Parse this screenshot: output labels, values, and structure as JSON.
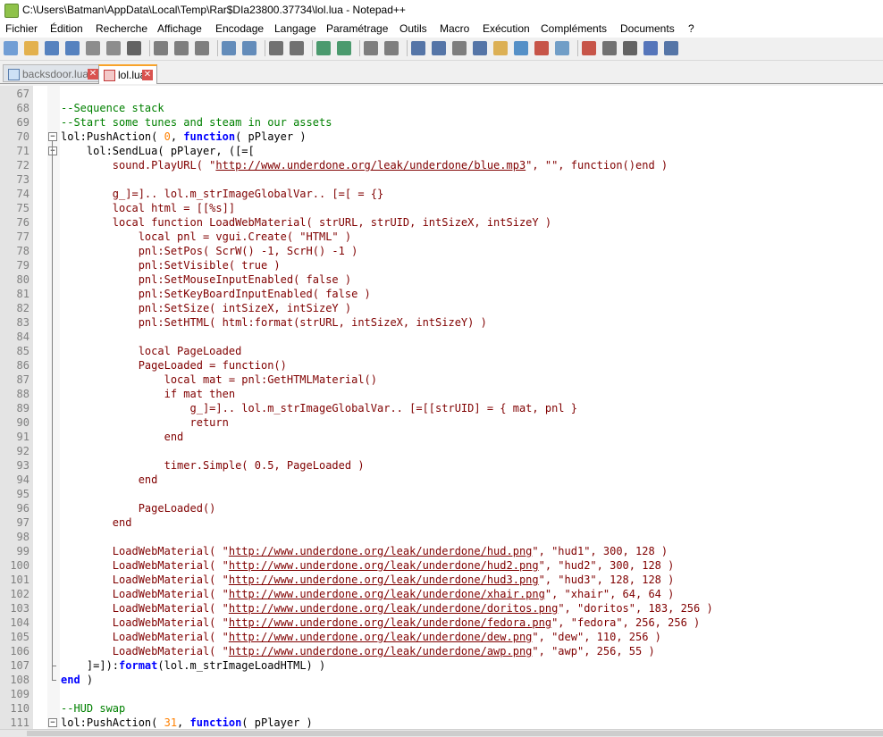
{
  "window": {
    "title": "C:\\Users\\Batman\\AppData\\Local\\Temp\\Rar$DIa23800.37734\\lol.lua - Notepad++"
  },
  "menu": [
    "Fichier",
    "Édition",
    "Recherche",
    "Affichage",
    "Encodage",
    "Langage",
    "Paramétrage",
    "Outils",
    "Macro",
    "Exécution",
    "Compléments",
    "Documents",
    "?"
  ],
  "tabs": [
    {
      "label": "backsdoor.lua",
      "close": "✕"
    },
    {
      "label": "lol.lua",
      "close": "✕"
    }
  ],
  "colors": {
    "comment": "#008000",
    "keyword": "#0000ff",
    "string": "#800000",
    "number": "#ff8000",
    "tab_accent": "#f8a32a"
  },
  "toolbar_icons": [
    "new-file-icon",
    "open-file-icon",
    "save-icon",
    "save-all-icon",
    "close-icon",
    "close-all-icon",
    "print-icon",
    "cut-icon",
    "copy-icon",
    "paste-icon",
    "undo-icon",
    "redo-icon",
    "find-icon",
    "replace-icon",
    "zoom-in-icon",
    "zoom-out-icon",
    "sync-vertical-icon",
    "sync-horizontal-icon",
    "word-wrap-icon",
    "show-all-chars-icon",
    "indent-guide-icon",
    "function-list-icon",
    "folder-workspace-icon",
    "doc-map-icon",
    "user-lang-icon",
    "monitor-icon",
    "record-macro-icon",
    "stop-macro-icon",
    "play-macro-icon",
    "run-macro-multiple-icon",
    "save-macro-icon"
  ],
  "code": [
    {
      "n": "67",
      "t": []
    },
    {
      "n": "68",
      "t": [
        {
          "c": "cm",
          "s": "--Sequence stack"
        }
      ]
    },
    {
      "n": "69",
      "t": [
        {
          "c": "cm",
          "s": "--Start some tunes and steam in our assets"
        }
      ]
    },
    {
      "n": "70",
      "t": [
        {
          "c": "",
          "s": "lol:PushAction( "
        },
        {
          "c": "num",
          "s": "0"
        },
        {
          "c": "",
          "s": ", "
        },
        {
          "c": "kw",
          "s": "function"
        },
        {
          "c": "",
          "s": "( pPlayer )"
        }
      ]
    },
    {
      "n": "71",
      "t": [
        {
          "c": "",
          "s": "    lol:SendLua( pPlayer, ([=["
        }
      ]
    },
    {
      "n": "72",
      "t": [
        {
          "c": "st",
          "s": "        sound.PlayURL( \""
        },
        {
          "c": "st ul",
          "s": "http://www.underdone.org/leak/underdone/blue.mp3"
        },
        {
          "c": "st",
          "s": "\", \"\", function()end )"
        }
      ]
    },
    {
      "n": "73",
      "t": []
    },
    {
      "n": "74",
      "t": [
        {
          "c": "st",
          "s": "        g_]=].. lol.m_strImageGlobalVar.. [=[ = {}"
        }
      ]
    },
    {
      "n": "75",
      "t": [
        {
          "c": "st",
          "s": "        local html = [[%s]]"
        }
      ]
    },
    {
      "n": "76",
      "t": [
        {
          "c": "st",
          "s": "        local function LoadWebMaterial( strURL, strUID, intSizeX, intSizeY )"
        }
      ]
    },
    {
      "n": "77",
      "t": [
        {
          "c": "st",
          "s": "            local pnl = vgui.Create( \"HTML\" )"
        }
      ]
    },
    {
      "n": "78",
      "t": [
        {
          "c": "st",
          "s": "            pnl:SetPos( ScrW() -1, ScrH() -1 )"
        }
      ]
    },
    {
      "n": "79",
      "t": [
        {
          "c": "st",
          "s": "            pnl:SetVisible( true )"
        }
      ]
    },
    {
      "n": "80",
      "t": [
        {
          "c": "st",
          "s": "            pnl:SetMouseInputEnabled( false )"
        }
      ]
    },
    {
      "n": "81",
      "t": [
        {
          "c": "st",
          "s": "            pnl:SetKeyBoardInputEnabled( false )"
        }
      ]
    },
    {
      "n": "82",
      "t": [
        {
          "c": "st",
          "s": "            pnl:SetSize( intSizeX, intSizeY )"
        }
      ]
    },
    {
      "n": "83",
      "t": [
        {
          "c": "st",
          "s": "            pnl:SetHTML( html:format(strURL, intSizeX, intSizeY) )"
        }
      ]
    },
    {
      "n": "84",
      "t": []
    },
    {
      "n": "85",
      "t": [
        {
          "c": "st",
          "s": "            local PageLoaded"
        }
      ]
    },
    {
      "n": "86",
      "t": [
        {
          "c": "st",
          "s": "            PageLoaded = function()"
        }
      ]
    },
    {
      "n": "87",
      "t": [
        {
          "c": "st",
          "s": "                local mat = pnl:GetHTMLMaterial()"
        }
      ]
    },
    {
      "n": "88",
      "t": [
        {
          "c": "st",
          "s": "                if mat then"
        }
      ]
    },
    {
      "n": "89",
      "t": [
        {
          "c": "st",
          "s": "                    g_]=].. lol.m_strImageGlobalVar.. [=[[strUID] = { mat, pnl }"
        }
      ]
    },
    {
      "n": "90",
      "t": [
        {
          "c": "st",
          "s": "                    return"
        }
      ]
    },
    {
      "n": "91",
      "t": [
        {
          "c": "st",
          "s": "                end"
        }
      ]
    },
    {
      "n": "92",
      "t": []
    },
    {
      "n": "93",
      "t": [
        {
          "c": "st",
          "s": "                timer.Simple( 0.5, PageLoaded )"
        }
      ]
    },
    {
      "n": "94",
      "t": [
        {
          "c": "st",
          "s": "            end"
        }
      ]
    },
    {
      "n": "95",
      "t": []
    },
    {
      "n": "96",
      "t": [
        {
          "c": "st",
          "s": "            PageLoaded()"
        }
      ]
    },
    {
      "n": "97",
      "t": [
        {
          "c": "st",
          "s": "        end"
        }
      ]
    },
    {
      "n": "98",
      "t": []
    },
    {
      "n": "99",
      "t": [
        {
          "c": "st",
          "s": "        LoadWebMaterial( \""
        },
        {
          "c": "st ul",
          "s": "http://www.underdone.org/leak/underdone/hud.png"
        },
        {
          "c": "st",
          "s": "\", \"hud1\", 300, 128 )"
        }
      ]
    },
    {
      "n": "100",
      "t": [
        {
          "c": "st",
          "s": "        LoadWebMaterial( \""
        },
        {
          "c": "st ul",
          "s": "http://www.underdone.org/leak/underdone/hud2.png"
        },
        {
          "c": "st",
          "s": "\", \"hud2\", 300, 128 )"
        }
      ]
    },
    {
      "n": "101",
      "t": [
        {
          "c": "st",
          "s": "        LoadWebMaterial( \""
        },
        {
          "c": "st ul",
          "s": "http://www.underdone.org/leak/underdone/hud3.png"
        },
        {
          "c": "st",
          "s": "\", \"hud3\", 128, 128 )"
        }
      ]
    },
    {
      "n": "102",
      "t": [
        {
          "c": "st",
          "s": "        LoadWebMaterial( \""
        },
        {
          "c": "st ul",
          "s": "http://www.underdone.org/leak/underdone/xhair.png"
        },
        {
          "c": "st",
          "s": "\", \"xhair\", 64, 64 )"
        }
      ]
    },
    {
      "n": "103",
      "t": [
        {
          "c": "st",
          "s": "        LoadWebMaterial( \""
        },
        {
          "c": "st ul",
          "s": "http://www.underdone.org/leak/underdone/doritos.png"
        },
        {
          "c": "st",
          "s": "\", \"doritos\", 183, 256 )"
        }
      ]
    },
    {
      "n": "104",
      "t": [
        {
          "c": "st",
          "s": "        LoadWebMaterial( \""
        },
        {
          "c": "st ul",
          "s": "http://www.underdone.org/leak/underdone/fedora.png"
        },
        {
          "c": "st",
          "s": "\", \"fedora\", 256, 256 )"
        }
      ]
    },
    {
      "n": "105",
      "t": [
        {
          "c": "st",
          "s": "        LoadWebMaterial( \""
        },
        {
          "c": "st ul",
          "s": "http://www.underdone.org/leak/underdone/dew.png"
        },
        {
          "c": "st",
          "s": "\", \"dew\", 110, 256 )"
        }
      ]
    },
    {
      "n": "106",
      "t": [
        {
          "c": "st",
          "s": "        LoadWebMaterial( \""
        },
        {
          "c": "st ul",
          "s": "http://www.underdone.org/leak/underdone/awp.png"
        },
        {
          "c": "st",
          "s": "\", \"awp\", 256, 55 )"
        }
      ]
    },
    {
      "n": "107",
      "t": [
        {
          "c": "",
          "s": "    ]=]):"
        },
        {
          "c": "kw",
          "s": "format"
        },
        {
          "c": "",
          "s": "(lol.m_strImageLoadHTML) )"
        }
      ]
    },
    {
      "n": "108",
      "t": [
        {
          "c": "kw",
          "s": "end"
        },
        {
          "c": "",
          "s": " )"
        }
      ]
    },
    {
      "n": "109",
      "t": []
    },
    {
      "n": "110",
      "t": [
        {
          "c": "cm",
          "s": "--HUD swap"
        }
      ]
    },
    {
      "n": "111",
      "t": [
        {
          "c": "",
          "s": "lol:PushAction( "
        },
        {
          "c": "num",
          "s": "31"
        },
        {
          "c": "",
          "s": ", "
        },
        {
          "c": "kw",
          "s": "function"
        },
        {
          "c": "",
          "s": "( pPlayer )"
        }
      ]
    }
  ]
}
